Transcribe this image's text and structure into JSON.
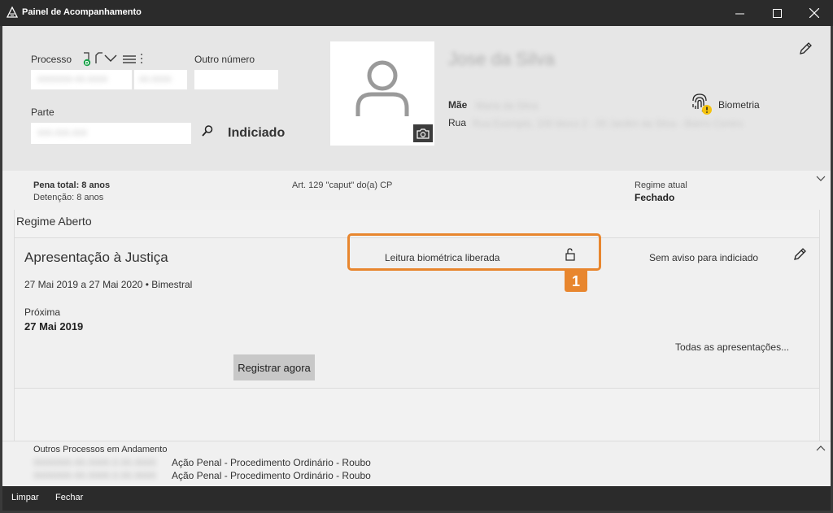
{
  "window": {
    "title": "Painel de Acompanhamento",
    "minimize_icon": "minimize-icon",
    "maximize_icon": "maximize-icon",
    "close_icon": "close-icon"
  },
  "header": {
    "processo_label": "Processo",
    "processo_value": "0000000-00.0000",
    "processo_value2": "00.0000",
    "outro_numero_label": "Outro número",
    "outro_numero_value": "",
    "parte_label": "Parte",
    "parte_value": "000.000.000",
    "indiciado_label": "Indiciado",
    "person_name": "Jose da Silva",
    "mae_label": "Mãe",
    "mae_value": "Maria da Silva",
    "rua_label": "Rua",
    "rua_value": "Rua Exemplo, 100 bloco 2 - 00 Jardim da Silva - Bairro Centro",
    "biometria_label": "Biometria",
    "colors": {
      "warning": "#f4c20d",
      "accent_green": "#1aa34a"
    }
  },
  "summary": {
    "pena_total": "Pena total: 8 anos",
    "detencao": "Detenção: 8 anos",
    "artigo": "Art. 129 \"caput\" do(a) CP",
    "regime_atual_label": "Regime atual",
    "regime_atual_value": "Fechado"
  },
  "regime": {
    "title": "Regime Aberto",
    "card": {
      "title": "Apresentação à Justiça",
      "biometric_status": "Leitura biométrica liberada",
      "aviso": "Sem aviso para indiciado",
      "periodo": "27 Mai 2019 a 27 Mai 2020 • Bimestral",
      "proxima_label": "Próxima",
      "proxima_value": "27 Mai 2019",
      "todas_link": "Todas as apresentações...",
      "registrar_button": "Registrar agora"
    },
    "callout_number": "1",
    "callout_color": "#e8862e"
  },
  "others": {
    "title": "Outros Processos em Andamento",
    "items": [
      {
        "numero": "0000000-00.0000.0.00.0000",
        "descricao": "Ação Penal - Procedimento Ordinário - Roubo"
      },
      {
        "numero": "0000000-00.0000.0.00.0000",
        "descricao": "Ação Penal - Procedimento Ordinário - Roubo"
      }
    ]
  },
  "footer": {
    "limpar": "Limpar",
    "fechar": "Fechar"
  }
}
